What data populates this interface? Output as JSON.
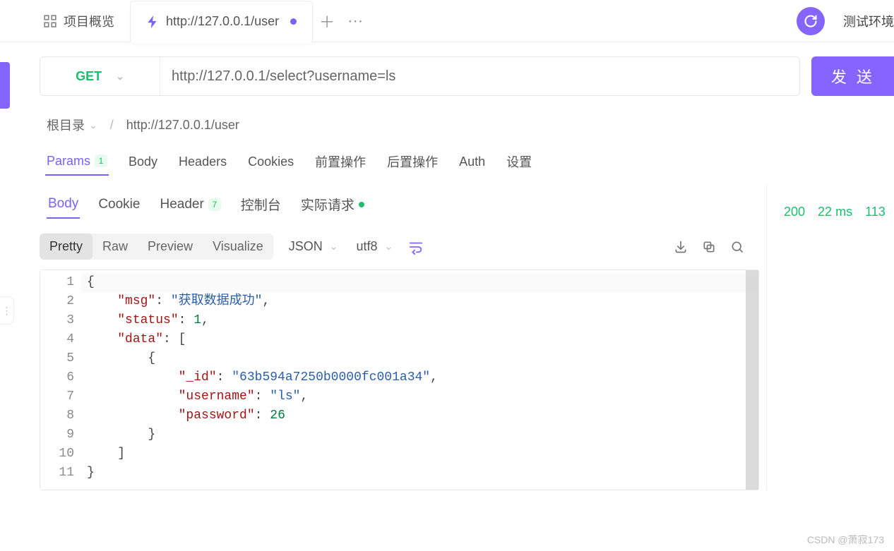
{
  "tabs": {
    "overview": "项目概览",
    "active": "http://127.0.0.1/user"
  },
  "topbar": {
    "env": "测试环境"
  },
  "request": {
    "method": "GET",
    "url": "http://127.0.0.1/select?username=ls",
    "send": "发 送"
  },
  "breadcrumb": {
    "root": "根目录",
    "sep": "/",
    "leaf": "http://127.0.0.1/user"
  },
  "req_tabs": {
    "params": "Params",
    "params_badge": "1",
    "body": "Body",
    "headers": "Headers",
    "cookies": "Cookies",
    "pre": "前置操作",
    "post": "后置操作",
    "auth": "Auth",
    "settings": "设置"
  },
  "resp_tabs": {
    "body": "Body",
    "cookie": "Cookie",
    "header": "Header",
    "header_badge": "7",
    "console": "控制台",
    "actual": "实际请求"
  },
  "toolbar": {
    "pretty": "Pretty",
    "raw": "Raw",
    "preview": "Preview",
    "visualize": "Visualize",
    "format": "JSON",
    "encoding": "utf8"
  },
  "status": {
    "code": "200",
    "time": "22 ms",
    "size": "113"
  },
  "response_body": {
    "lines": [
      "1",
      "2",
      "3",
      "4",
      "5",
      "6",
      "7",
      "8",
      "9",
      "10",
      "11"
    ],
    "msg_key": "\"msg\"",
    "msg_val": "\"获取数据成功\"",
    "status_key": "\"status\"",
    "status_val": "1",
    "data_key": "\"data\"",
    "id_key": "\"_id\"",
    "id_val": "\"63b594a7250b0000fc001a34\"",
    "user_key": "\"username\"",
    "user_val": "\"ls\"",
    "pw_key": "\"password\"",
    "pw_val": "26"
  },
  "watermark": "CSDN @萧寂173"
}
